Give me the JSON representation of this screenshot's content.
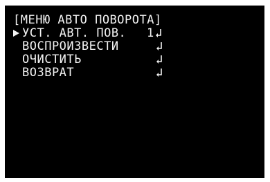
{
  "menu": {
    "title": "[МЕНЮ АВТО ПОВОРОТА]",
    "items": [
      {
        "label": "УСТ. АВТ. ПОВ.",
        "value": "1",
        "icon": "enter-icon",
        "selected": true
      },
      {
        "label": "ВОСПРОИЗВЕСТИ",
        "value": "",
        "icon": "enter-icon",
        "selected": false
      },
      {
        "label": "ОЧИСТИТЬ",
        "value": "",
        "icon": "enter-icon",
        "selected": false
      },
      {
        "label": "ВОЗВРАТ",
        "value": "",
        "icon": "enter-icon",
        "selected": false
      }
    ]
  },
  "colors": {
    "background": "#000000",
    "text": "#f2f2f2"
  }
}
